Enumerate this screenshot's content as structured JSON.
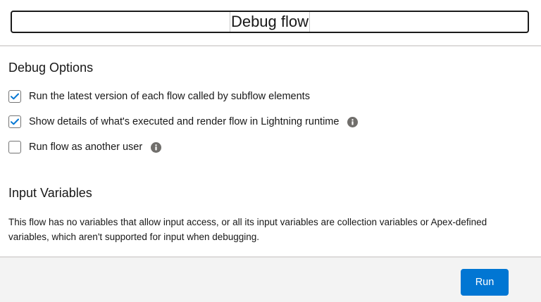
{
  "modal": {
    "title": "Debug flow"
  },
  "debug_options": {
    "heading": "Debug Options",
    "options": [
      {
        "label": "Run the latest version of each flow called by subflow elements",
        "checked": true,
        "info": false
      },
      {
        "label": "Show details of what's executed and render flow in Lightning runtime",
        "checked": true,
        "info": true
      },
      {
        "label": "Run flow as another user",
        "checked": false,
        "info": true
      }
    ]
  },
  "input_variables": {
    "heading": "Input Variables",
    "description": "This flow has no variables that allow input access, or all its input variables are collection variables or Apex-defined variables, which aren't supported for input when debugging."
  },
  "footer": {
    "run_label": "Run"
  },
  "colors": {
    "brand": "#0176d3",
    "check": "#0176d3",
    "info_icon": "#706e6b",
    "footer_bg": "#f3f3f3"
  }
}
